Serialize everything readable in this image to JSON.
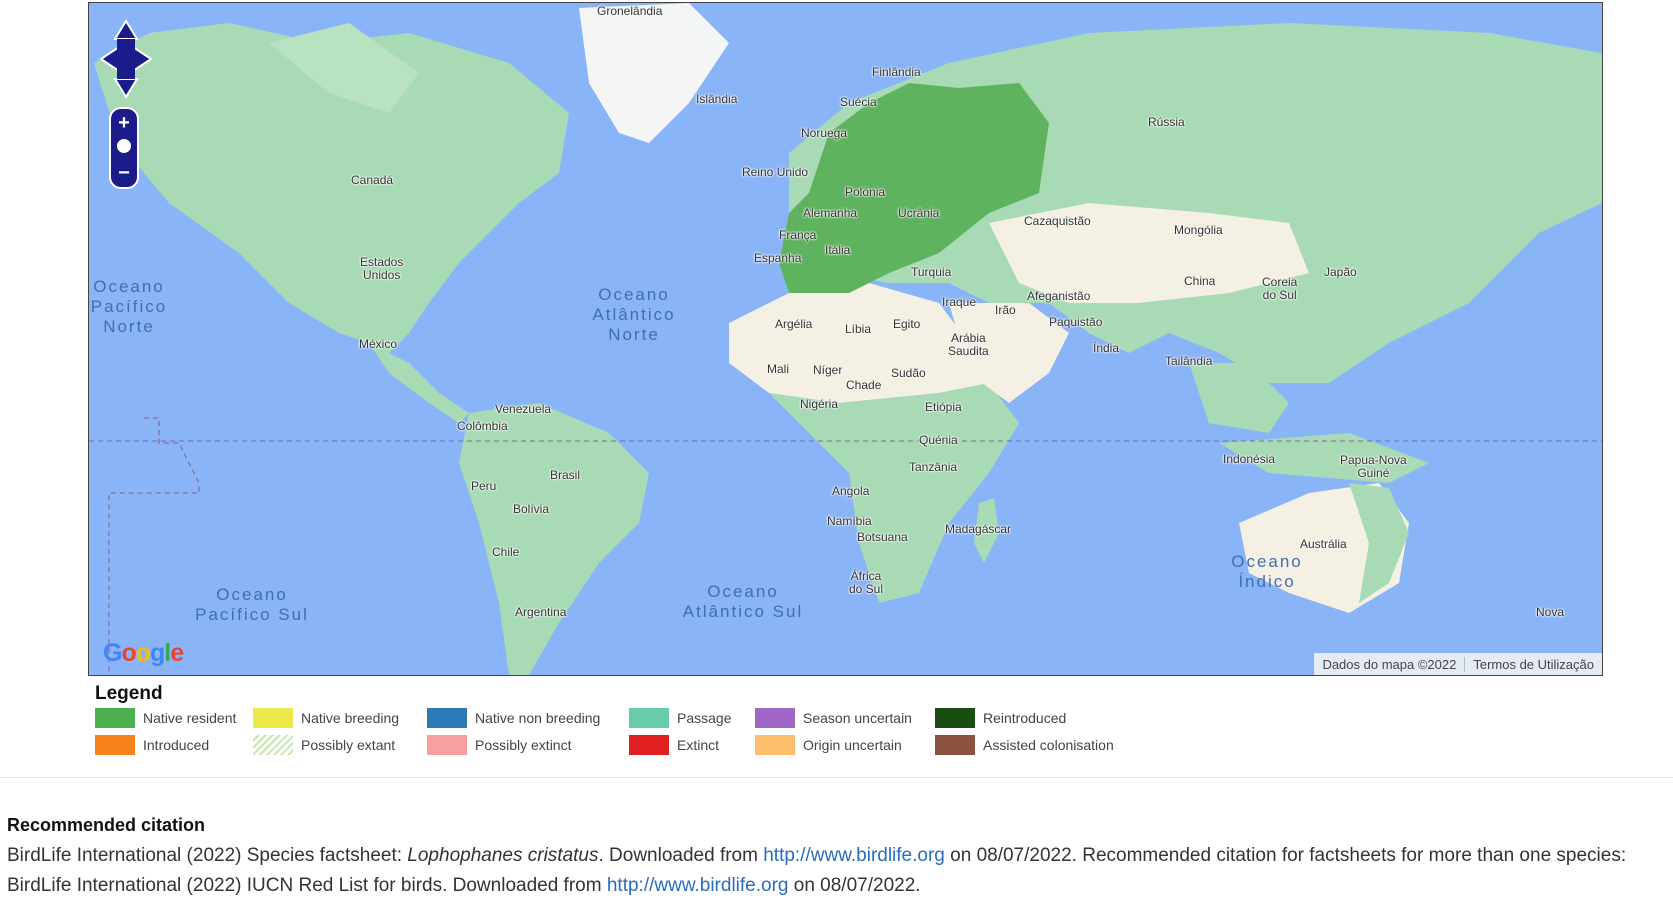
{
  "map": {
    "countries": {
      "greenland": "Gronelândia",
      "iceland": "Islândia",
      "finland": "Finlândia",
      "sweden": "Suécia",
      "norway": "Noruega",
      "uk": "Reino Unido",
      "poland": "Polónia",
      "germany": "Alemanha",
      "ukraine": "Ucrânia",
      "france": "França",
      "italy": "Itália",
      "spain": "Espanha",
      "turkey": "Turquia",
      "russia": "Rússia",
      "kazakhstan": "Cazaquistão",
      "mongolia": "Mongólia",
      "china": "China",
      "south_korea_1": "Coreia",
      "south_korea_2": "do Sul",
      "japan": "Japão",
      "afghanistan": "Afeganistão",
      "iran": "Irão",
      "iraq": "Iraque",
      "pakistan": "Paquistão",
      "saudi_1": "Arábia",
      "saudi_2": "Saudita",
      "india": "Índia",
      "thailand": "Tailândia",
      "egypt": "Egito",
      "libya": "Líbia",
      "algeria": "Argélia",
      "mali": "Mali",
      "niger": "Níger",
      "chad": "Chade",
      "sudan": "Sudão",
      "nigeria": "Nigéria",
      "ethiopia": "Etiópia",
      "kenya": "Quénia",
      "tanzania": "Tanzânia",
      "angola": "Angola",
      "namibia": "Namíbia",
      "botswana": "Botsuana",
      "south_africa_1": "África",
      "south_africa_2": "do Sul",
      "madagascar": "Madagáscar",
      "indonesia": "Indonésia",
      "png_1": "Papua-Nova",
      "png_2": "Guiné",
      "australia": "Austrália",
      "canada": "Canadá",
      "usa_1": "Estados",
      "usa_2": "Unidos",
      "mexico": "México",
      "venezuela": "Venezuela",
      "colombia": "Colômbia",
      "brazil": "Brasil",
      "peru": "Peru",
      "bolivia": "Bolívia",
      "chile": "Chile",
      "argentina": "Argentina",
      "new_zealand": "Nova"
    },
    "oceans": {
      "north_pacific": "Oceano\nPacífico\nNorte",
      "north_atlantic": "Oceano\nAtlântico\nNorte",
      "south_pacific": "Oceano\nPacífico Sul",
      "south_atlantic": "Oceano\nAtlântico Sul",
      "indian": "Oceano\nÍndico"
    },
    "attribution": {
      "map_data": "Dados do mapa ©2022",
      "terms": "Termos de Utilização"
    },
    "logo": "Google",
    "zoom_in": "+",
    "zoom_out": "−",
    "colors": {
      "ocean": "#8ab4f8",
      "land": "#a8dab5",
      "desert": "#f5f0e4",
      "range_native_resident": "#5fb35f"
    }
  },
  "legend": {
    "title": "Legend",
    "items": [
      {
        "label": "Native resident",
        "color": "#4caf50"
      },
      {
        "label": "Native breeding",
        "color": "#ebe84a"
      },
      {
        "label": "Native non breeding",
        "color": "#2c7bb6"
      },
      {
        "label": "Passage",
        "color": "#66ccaa"
      },
      {
        "label": "Season uncertain",
        "color": "#a066c8"
      },
      {
        "label": "Reintroduced",
        "color": "#1a4d12"
      },
      {
        "label": "Introduced",
        "color": "#f8821a"
      },
      {
        "label": "Possibly extant",
        "color": "#c8e6a8",
        "pattern": "hatched"
      },
      {
        "label": "Possibly extinct",
        "color": "#f7a0a0"
      },
      {
        "label": "Extinct",
        "color": "#e02020"
      },
      {
        "label": "Origin uncertain",
        "color": "#fcbf6e"
      },
      {
        "label": "Assisted colonisation",
        "color": "#8b5240"
      }
    ]
  },
  "citation": {
    "title": "Recommended citation",
    "part1": "BirdLife International (2022) Species factsheet: ",
    "species": "Lophophanes cristatus",
    "part2": ". Downloaded from ",
    "link1": "http://www.birdlife.org",
    "part3": " on 08/07/2022. Recommended citation for factsheets for more than one species: BirdLife International (2022) IUCN Red List for birds. Downloaded from ",
    "link2": "http://www.birdlife.org",
    "part4": " on 08/07/2022."
  }
}
